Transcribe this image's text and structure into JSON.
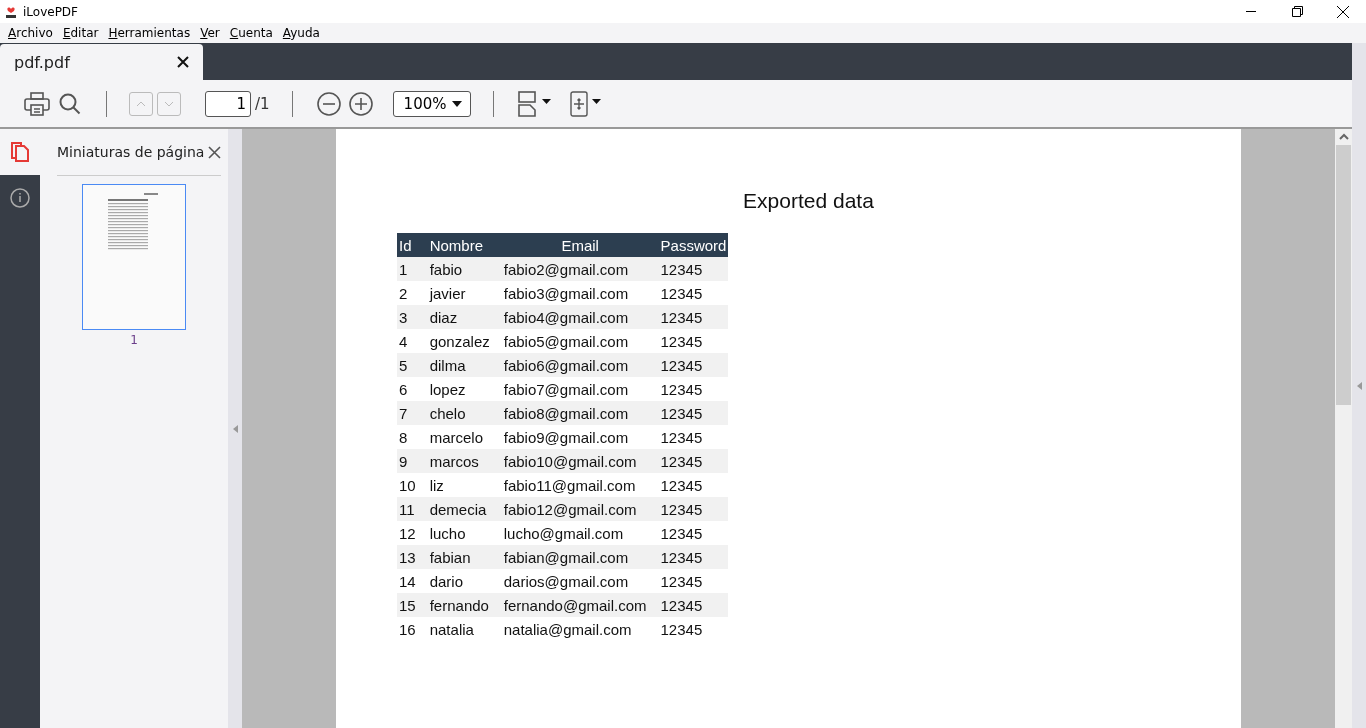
{
  "window": {
    "title": "iLovePDF"
  },
  "menu": [
    "Archivo",
    "Editar",
    "Herramientas",
    "Ver",
    "Cuenta",
    "Ayuda"
  ],
  "tabs": [
    {
      "label": "pdf.pdf",
      "selected": true
    }
  ],
  "toolbar": {
    "page": "1",
    "page_total": "/1",
    "zoom": "100%"
  },
  "rail": [
    {
      "kind": "pages",
      "selected": true
    },
    {
      "kind": "info",
      "selected": false
    }
  ],
  "sidebar": {
    "title": "Miniaturas de página",
    "thumbnails": [
      {
        "label": "1",
        "selected": true
      }
    ]
  },
  "document": {
    "title": "Exported data",
    "columns": [
      "Id",
      "Nombre",
      "Email",
      "Password"
    ],
    "rows": [
      [
        "1",
        "fabio",
        "fabio2@gmail.com",
        "12345"
      ],
      [
        "2",
        "javier",
        "fabio3@gmail.com",
        "12345"
      ],
      [
        "3",
        "diaz",
        "fabio4@gmail.com",
        "12345"
      ],
      [
        "4",
        "gonzalez",
        "fabio5@gmail.com",
        "12345"
      ],
      [
        "5",
        "dilma",
        "fabio6@gmail.com",
        "12345"
      ],
      [
        "6",
        "lopez",
        "fabio7@gmail.com",
        "12345"
      ],
      [
        "7",
        "chelo",
        "fabio8@gmail.com",
        "12345"
      ],
      [
        "8",
        "marcelo",
        "fabio9@gmail.com",
        "12345"
      ],
      [
        "9",
        "marcos",
        "fabio10@gmail.com",
        "12345"
      ],
      [
        "10",
        "liz",
        "fabio11@gmail.com",
        "12345"
      ],
      [
        "11",
        "demecia",
        "fabio12@gmail.com",
        "12345"
      ],
      [
        "12",
        "lucho",
        "lucho@gmail.com",
        "12345"
      ],
      [
        "13",
        "fabian",
        "fabian@gmail.com",
        "12345"
      ],
      [
        "14",
        "dario",
        "darios@gmail.com",
        "12345"
      ],
      [
        "15",
        "fernando",
        "fernando@gmail.com",
        "12345"
      ],
      [
        "16",
        "natalia",
        "natalia@gmail.com",
        "12345"
      ]
    ]
  }
}
